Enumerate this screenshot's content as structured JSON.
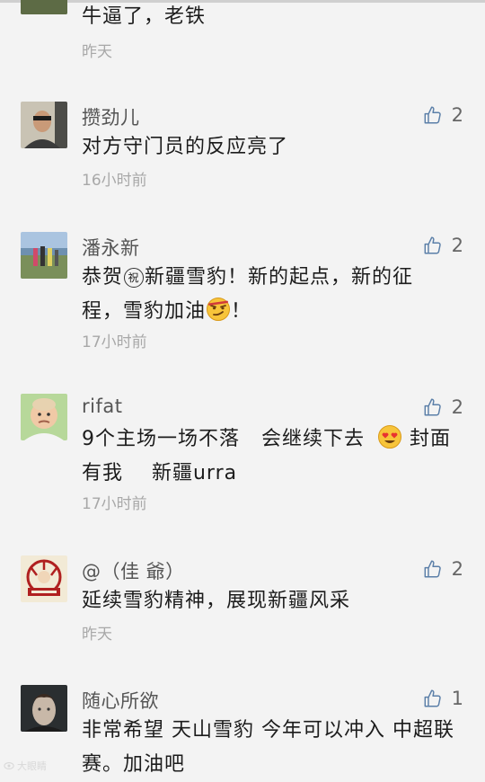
{
  "comments": [
    {
      "name": "",
      "body_lines": [
        "牛逼了，老铁"
      ],
      "time": "昨天"
    },
    {
      "name": "攒劲儿",
      "likes": "2",
      "body_lines": [
        "对方守门员的反应亮了"
      ],
      "time": "16小时前"
    },
    {
      "name": "潘永新",
      "likes": "2",
      "body_line1": "恭贺",
      "body_circled": "祝",
      "body_line1b": "新疆雪豹！新的起点，新的征",
      "body_line2": "程，雪豹加油",
      "body_line2b": "！",
      "time": "17小时前"
    },
    {
      "name": "rifat",
      "likes": "2",
      "body_line1": "9个主场一场不落   会继续下去",
      "body_line1b": "封面",
      "body_line2": "有我    新疆urra",
      "time": "17小时前"
    },
    {
      "name": "@（佳 爺）",
      "likes": "2",
      "body_lines": [
        "延续雪豹精神，展现新疆风采"
      ],
      "time": "昨天"
    },
    {
      "name": "随心所欲",
      "likes": "1",
      "body_line1": "非常希望 天山雪豹 今年可以冲入 中超联",
      "body_line2": "赛。加油吧"
    }
  ],
  "watermark": "大眼睛",
  "icons": {
    "like": "thumbs-up-icon",
    "emoji_smirk": "smirk-face-icon",
    "emoji_heart_eyes": "heart-eyes-face-icon"
  },
  "colors": {
    "background": "#f3f3f3",
    "like_icon": "#5b7fa8",
    "time_text": "#a8a8a8"
  }
}
